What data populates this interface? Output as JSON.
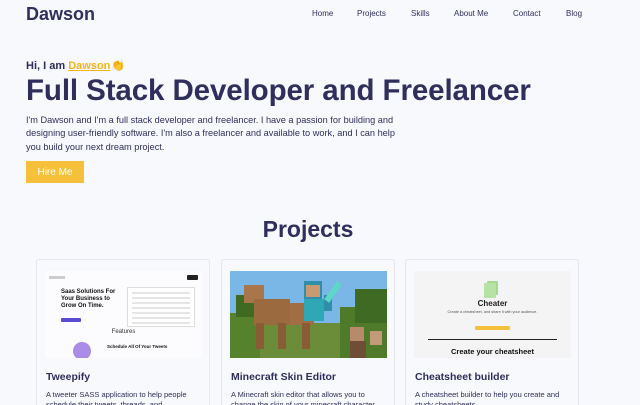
{
  "brand": "Dawson",
  "nav": {
    "items": [
      "Home",
      "Projects",
      "Skills",
      "About Me",
      "Contact",
      "Blog"
    ]
  },
  "hero": {
    "greeting": "Hi, I am",
    "name": "Dawson",
    "wave": "👏",
    "title": "Full Stack Developer and Freelancer",
    "description": "I'm Dawson and I'm a full stack developer and freelancer. I have a passion for building and designing user-friendly software. I'm also a freelancer and available to work, and I can help you build your next dream project.",
    "cta": "Hire Me"
  },
  "projects": {
    "heading": "Projects",
    "cards": [
      {
        "title": "Tweepify",
        "description": "A tweeter SASS application to help people schedule their tweets, threads, and",
        "image": {
          "headline": "Saas Solutions For Your Business to Grow On Time.",
          "features": "Features",
          "schedule": "Schedule All Of Your Tweets"
        }
      },
      {
        "title": "Minecraft Skin Editor",
        "description": "A Minecraft skin editor that allows you to change the skin of your minecraft character",
        "image": {}
      },
      {
        "title": "Cheatsheet builder",
        "description": "A cheatsheet builder to help you create and study cheatsheets.",
        "image": {
          "app_name": "Cheater",
          "tagline": "Create a cheatsheet, and share it with your audience.",
          "banner": "Create your cheatsheet"
        }
      }
    ]
  },
  "colors": {
    "primary": "#2f2e5c",
    "accent": "#f5c13a",
    "background": "#f8f9fc"
  }
}
